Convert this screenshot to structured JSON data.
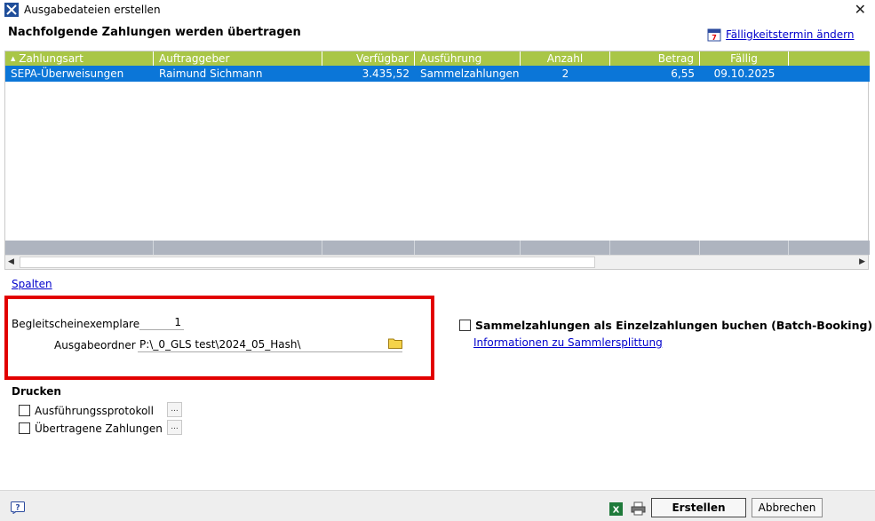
{
  "window": {
    "title": "Ausgabedateien erstellen",
    "close_glyph": "✕"
  },
  "header": {
    "heading": "Nachfolgende Zahlungen werden übertragen",
    "due_link": "Fälligkeitstermin ändern"
  },
  "grid": {
    "columns": [
      "Zahlungsart",
      "Auftraggeber",
      "Verfügbar",
      "Ausführung",
      "Anzahl",
      "Betrag",
      "Fällig"
    ],
    "rows": [
      [
        "SEPA-Überweisungen",
        "Raimund Sichmann",
        "3.435,52",
        "Sammelzahlungen",
        "2",
        "6,55",
        "09.10.2025"
      ]
    ],
    "sort_glyph": "▲"
  },
  "spalten_link": "Spalten",
  "options": {
    "begleit_label": "Begleitscheinexemplare",
    "begleit_value": "1",
    "ordner_label": "Ausgabeordner",
    "ordner_value": "P:\\_0_GLS test\\2024_05_Hash\\"
  },
  "batch": {
    "label": "Sammelzahlungen als Einzelzahlungen buchen (Batch-Booking)",
    "checked": false,
    "info_link": "Informationen zu Sammlersplittung"
  },
  "drucken": {
    "heading": "Drucken",
    "items": [
      {
        "label": "Ausführungssprotokoll",
        "checked": false
      },
      {
        "label": "Übertragene Zahlungen",
        "checked": false
      }
    ],
    "dots": "..."
  },
  "footer": {
    "create_label": "Erstellen",
    "cancel_label": "Abbrechen"
  },
  "icons": {
    "app": "app-logo-icon",
    "calendar": "calendar-icon",
    "folder": "folder-icon",
    "help": "help-icon",
    "excel": "excel-icon",
    "print": "printer-icon"
  },
  "colors": {
    "header_green": "#a9c647",
    "selection_blue": "#0b76d8",
    "highlight_red": "#e20000",
    "link_blue": "#0000cc"
  }
}
